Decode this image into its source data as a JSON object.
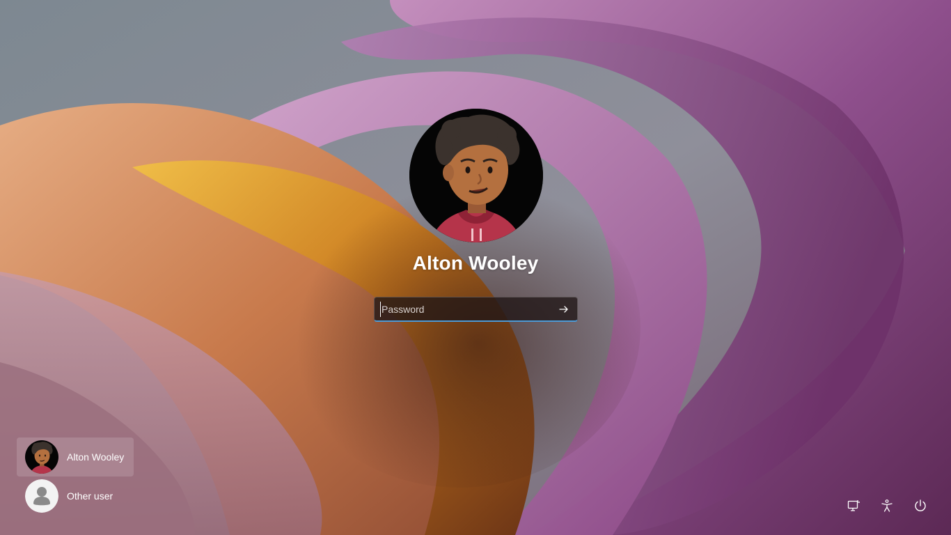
{
  "login": {
    "username": "Alton Wooley",
    "password_placeholder": "Password",
    "password_value": ""
  },
  "users": [
    {
      "name": "Alton Wooley",
      "avatar": "cartoon-avatar",
      "selected": true
    },
    {
      "name": "Other user",
      "avatar": "generic-user-icon",
      "selected": false
    }
  ],
  "system_buttons": [
    {
      "icon": "network-icon"
    },
    {
      "icon": "accessibility-icon"
    },
    {
      "icon": "power-icon"
    }
  ],
  "colors": {
    "accent": "#4c9ad6",
    "text": "#ffffff"
  }
}
